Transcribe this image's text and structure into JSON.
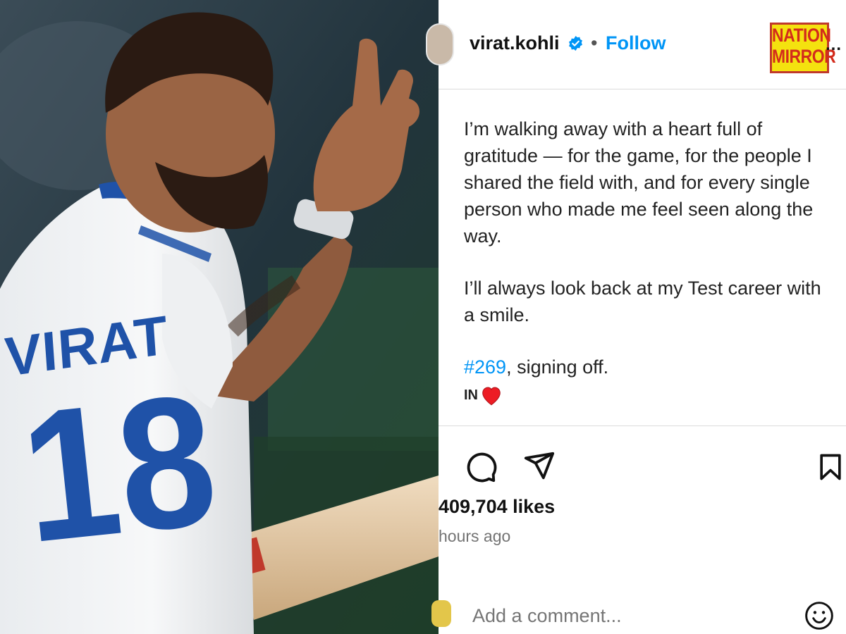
{
  "post": {
    "username": "virat.kohli",
    "separator": "•",
    "follow_label": "Follow",
    "more_label": "...",
    "caption_paragraphs": [
      "I’m walking away with a heart full of gratitude — for the game, for the people I shared the field with, and for every single person who made me feel seen along the way.",
      "I’ll always look back at my Test career with a smile."
    ],
    "hashtag": "#269",
    "signoff_rest": ", signing off.",
    "flag_text": "IN",
    "likes_text": "409,704 likes",
    "time_text": "hours ago",
    "comment_placeholder": "Add a comment..."
  },
  "watermark": {
    "line1": "NATION",
    "line2": "MIRROR"
  },
  "photo": {
    "jersey_name": "VIRAT",
    "jersey_number": "18"
  },
  "colors": {
    "accent": "#0095f6",
    "heart": "#ed1c24",
    "logo_bg": "#f4e20f",
    "logo_text": "#d32b1c"
  },
  "icons": [
    "verified-icon",
    "comment-icon",
    "share-icon",
    "bookmark-icon",
    "heart-icon",
    "emoji-icon"
  ]
}
